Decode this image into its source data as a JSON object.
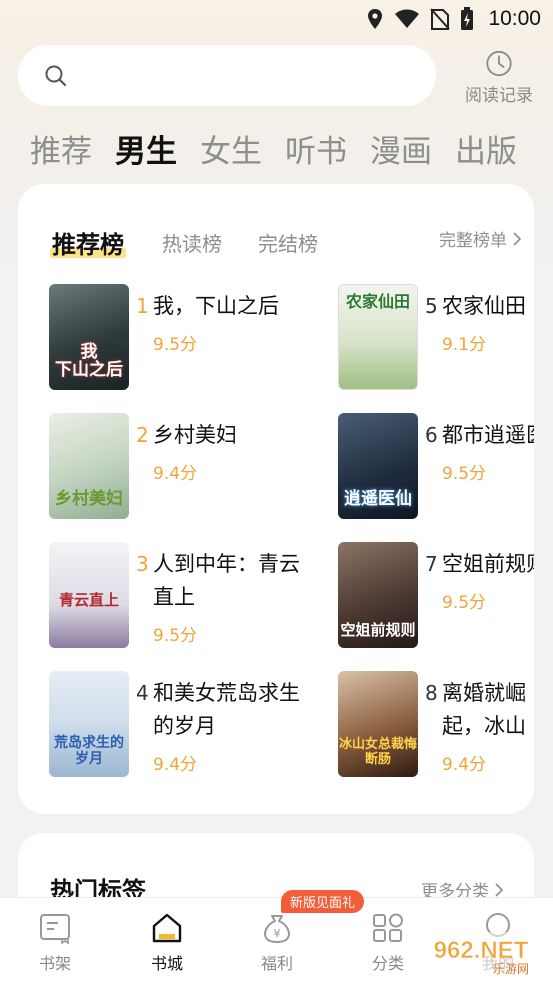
{
  "status": {
    "time": "10:00"
  },
  "search": {
    "placeholder": ""
  },
  "history": {
    "label": "阅读记录"
  },
  "channels": [
    "推荐",
    "男生",
    "女生",
    "听书",
    "漫画",
    "出版"
  ],
  "rank": {
    "tabs": [
      "推荐榜",
      "热读榜",
      "完结榜"
    ],
    "full_list": "完整榜单",
    "books": [
      {
        "rank": "1",
        "title": "我，下山之后",
        "score": "9.5分",
        "cover_text": "我\n下山之后"
      },
      {
        "rank": "2",
        "title": "乡村美妇",
        "score": "9.4分",
        "cover_text": "乡村美妇"
      },
      {
        "rank": "3",
        "title": "人到中年：青云直上",
        "score": "9.5分",
        "cover_text": "青云直上"
      },
      {
        "rank": "4",
        "title": "和美女荒岛求生的岁月",
        "score": "9.4分",
        "cover_text": "荒岛求生的岁月"
      },
      {
        "rank": "5",
        "title": "农家仙田",
        "score": "9.1分",
        "cover_text": "农家仙田"
      },
      {
        "rank": "6",
        "title": "都市逍遥医",
        "score": "9.5分",
        "cover_text": "逍遥医仙"
      },
      {
        "rank": "7",
        "title": "空姐前规则",
        "score": "9.5分",
        "cover_text": "空姐前规则"
      },
      {
        "rank": "8",
        "title": "离婚就崛起，冰山女总裁悔",
        "score": "9.4分",
        "cover_text": "冰山女总裁悔断肠"
      }
    ]
  },
  "tags": {
    "title": "热门标签",
    "more": "更多分类"
  },
  "nav": {
    "items": [
      "书架",
      "书城",
      "福利",
      "分类",
      "我的"
    ],
    "badge": "新版见面礼"
  },
  "watermark": {
    "text": "962.NET",
    "sub": "乐游网"
  },
  "colors": {
    "accent": "#f0a53a",
    "badge": "#f25d3a",
    "highlight": "#fde48a"
  }
}
